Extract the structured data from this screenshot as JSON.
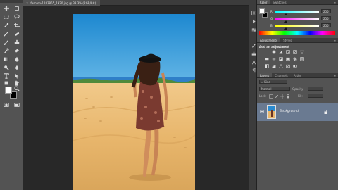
{
  "document": {
    "tab_title": "fashion-1283855_1920.jpg @ 33.3% (RGB/8#)",
    "close_glyph": "×"
  },
  "toolbox": {
    "tools": [
      "move-icon",
      "artboard-icon",
      "marquee-icon",
      "lasso-icon",
      "quick-select-icon",
      "crop-icon",
      "eyedropper-icon",
      "healing-brush-icon",
      "brush-icon",
      "clone-stamp-icon",
      "history-brush-icon",
      "eraser-icon",
      "gradient-icon",
      "blur-icon",
      "dodge-icon",
      "pen-icon",
      "type-icon",
      "path-select-icon",
      "shape-icon",
      "hand-icon",
      "zoom-icon"
    ],
    "foreground_color": "#ffffff",
    "background_color": "#000000"
  },
  "color_panel": {
    "tabs": [
      "Color",
      "Swatches"
    ],
    "channels": [
      {
        "label": "R",
        "value": "255",
        "gradient_from": "#00ffff",
        "gradient_to": "#ffffff"
      },
      {
        "label": "G",
        "value": "255",
        "gradient_from": "#ff00ff",
        "gradient_to": "#ffffff"
      },
      {
        "label": "B",
        "value": "255",
        "gradient_from": "#ffff00",
        "gradient_to": "#ffffff"
      }
    ]
  },
  "adjustments_panel": {
    "tabs": [
      "Adjustments",
      "Styles"
    ],
    "title": "Add an adjustment"
  },
  "layers_panel": {
    "tabs": [
      "Layers",
      "Channels",
      "Paths"
    ],
    "filter_label": "Kind",
    "blend_mode": "Normal",
    "opacity_label": "Opacity:",
    "lock_label": "Lock:",
    "fill_label": "Fill:",
    "layers": [
      {
        "name": "Background",
        "visible": true,
        "locked": true
      }
    ]
  },
  "colors": {
    "ui_panel": "#535353",
    "ui_dark": "#3c3c3c",
    "canvas_bg": "#282828",
    "selected_layer": "#6a7a91"
  }
}
